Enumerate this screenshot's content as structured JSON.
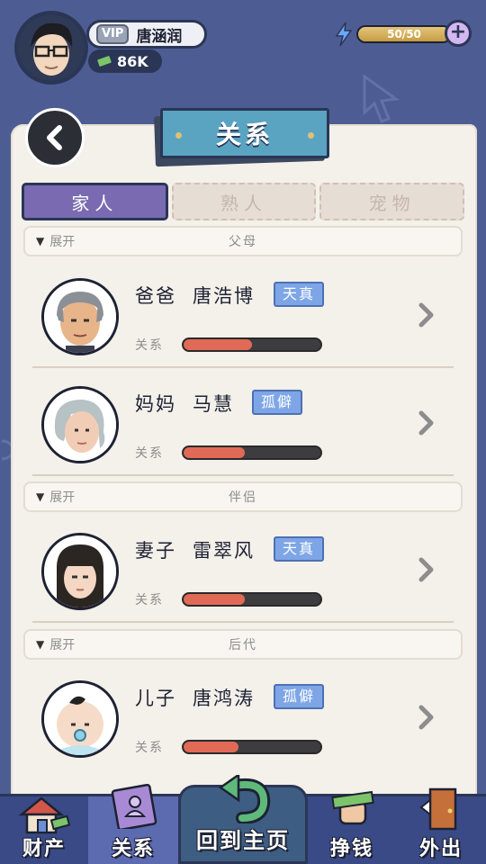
{
  "header": {
    "vip_label": "VIP",
    "player_name": "唐涵润",
    "money": "86K",
    "energy_text": "50/50",
    "energy_fraction": 1.0,
    "plus_label": "+"
  },
  "page_title": "关系",
  "tabs": [
    {
      "label": "家人",
      "active": true
    },
    {
      "label": "熟人",
      "active": false
    },
    {
      "label": "宠物",
      "active": false
    }
  ],
  "sections": [
    {
      "expand_label": "展开",
      "title": "父母",
      "members": [
        {
          "relation": "爸爸",
          "name": "唐浩博",
          "trait": "天真",
          "bar_label": "关系",
          "relationship": 0.5
        },
        {
          "relation": "妈妈",
          "name": "马慧",
          "trait": "孤僻",
          "bar_label": "关系",
          "relationship": 0.45
        }
      ]
    },
    {
      "expand_label": "展开",
      "title": "伴侣",
      "members": [
        {
          "relation": "妻子",
          "name": "雷翠风",
          "trait": "天真",
          "bar_label": "关系",
          "relationship": 0.45
        }
      ]
    },
    {
      "expand_label": "展开",
      "title": "后代",
      "members": [
        {
          "relation": "儿子",
          "name": "唐鸿涛",
          "trait": "孤僻",
          "bar_label": "关系",
          "relationship": 0.4
        }
      ]
    }
  ],
  "bottom_nav": {
    "assets": "财产",
    "relations": "关系",
    "home": "回到主页",
    "earn": "挣钱",
    "outing": "外出"
  },
  "colors": {
    "background": "#4d5d94",
    "paper": "#f4f0ea",
    "active_tab": "#7a6ab1",
    "title_card": "#5aa4c2",
    "trait_badge": "#7ea6e6",
    "bar_fill": "#e06a56"
  }
}
